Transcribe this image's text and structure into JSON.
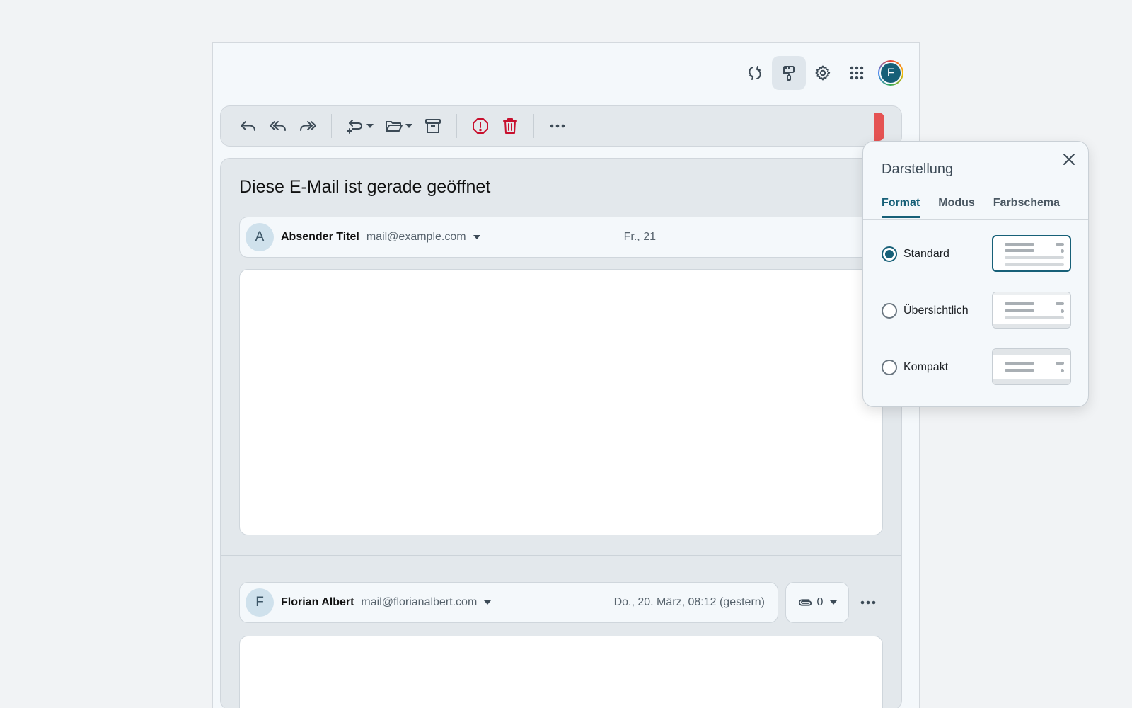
{
  "topbar": {
    "icons": [
      "sync-icon",
      "paint-roller-icon",
      "gear-icon",
      "apps-grid-icon"
    ],
    "avatar_initial": "F"
  },
  "toolbar": {
    "icons": [
      "reply-icon",
      "reply-all-icon",
      "forward-icon",
      "return-icon",
      "folder-move-icon",
      "archive-icon",
      "spam-icon",
      "trash-icon",
      "more-icon"
    ]
  },
  "main": {
    "subject": "Diese E-Mail ist gerade geöffnet",
    "messages": [
      {
        "avatar_initial": "A",
        "sender": "Absender Titel",
        "email": "mail@example.com",
        "date": "Fr., 21"
      },
      {
        "avatar_initial": "F",
        "sender": "Florian Albert",
        "email": "mail@florianalbert.com",
        "date": "Do., 20. März, 08:12 (gestern)",
        "attachments_count": "0"
      }
    ]
  },
  "popover": {
    "title": "Darstellung",
    "tabs": [
      {
        "label": "Format",
        "active": true
      },
      {
        "label": "Modus",
        "active": false
      },
      {
        "label": "Farbschema",
        "active": false
      }
    ],
    "options": [
      {
        "label": "Standard",
        "checked": true
      },
      {
        "label": "Übersichtlich",
        "checked": false
      },
      {
        "label": "Kompakt",
        "checked": false
      }
    ]
  },
  "colors": {
    "accent": "#176078",
    "danger": "#c8102e"
  }
}
